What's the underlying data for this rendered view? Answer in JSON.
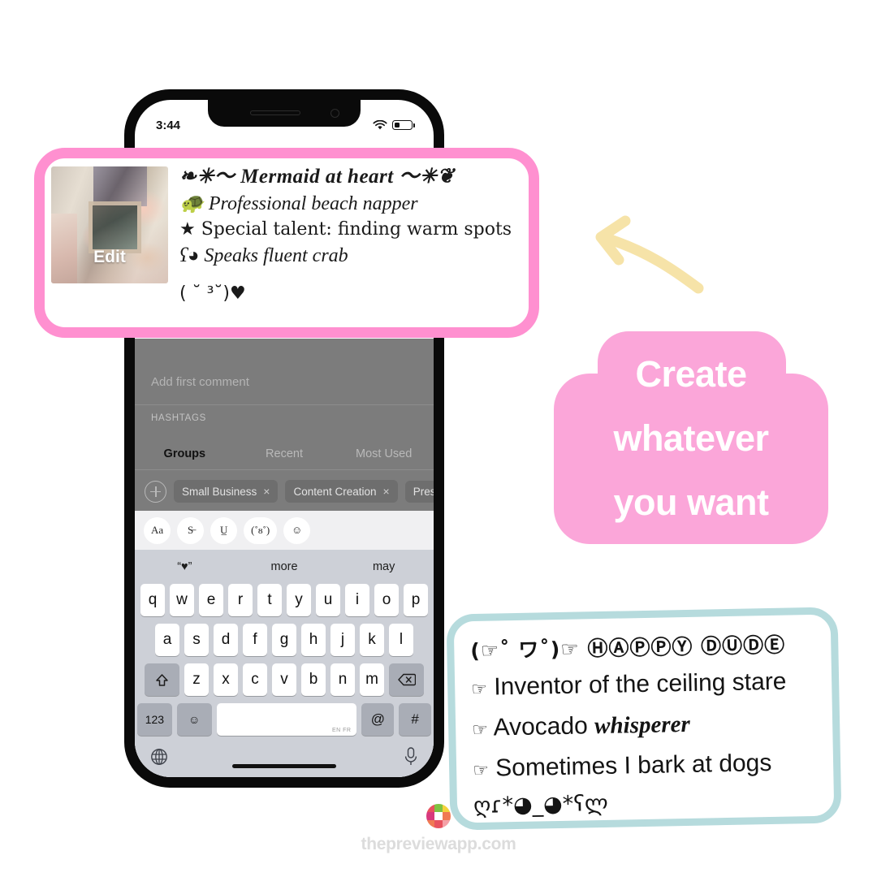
{
  "phone": {
    "status_bar": {
      "time": "3:44",
      "wifi_icon": "wifi-icon",
      "battery_icon": "battery-low-icon"
    },
    "comment_placeholder": "Add first comment",
    "hashtags_label": "HASHTAGS",
    "tabs": [
      {
        "label": "Groups",
        "active": true
      },
      {
        "label": "Recent",
        "active": false
      },
      {
        "label": "Most Used",
        "active": false
      }
    ],
    "chips": [
      {
        "label": "Small Business",
        "close": "×"
      },
      {
        "label": "Content Creation",
        "close": "×"
      },
      {
        "label": "Presets",
        "close": ""
      }
    ],
    "add_chip_icon": "plus-circle-icon",
    "format_buttons": [
      {
        "label": "Aa",
        "name": "font-size-button"
      },
      {
        "label": "S̶",
        "name": "strikethrough-button"
      },
      {
        "label": "U̲",
        "name": "underline-button"
      },
      {
        "label": "(˚ᴕ˚)",
        "name": "kaomoji-button"
      },
      {
        "label": "☺",
        "name": "emoji-button"
      }
    ],
    "keyboard": {
      "predictions": [
        "“♥”",
        "more",
        "may"
      ],
      "row1": [
        "q",
        "w",
        "e",
        "r",
        "t",
        "y",
        "u",
        "i",
        "o",
        "p"
      ],
      "row2": [
        "a",
        "s",
        "d",
        "f",
        "g",
        "h",
        "j",
        "k",
        "l"
      ],
      "shift_icon": "shift-icon",
      "row3": [
        "z",
        "x",
        "c",
        "v",
        "b",
        "n",
        "m"
      ],
      "backspace_icon": "backspace-icon",
      "numbers_key": "123",
      "emoji_key": "☺",
      "space_hint": "EN FR",
      "at_key": "@",
      "hash_key": "#",
      "globe_icon": "globe-icon",
      "mic_icon": "microphone-icon"
    }
  },
  "bio_card": {
    "thumbnail_label": "Edit",
    "lines": [
      "❧✳～ Mermaid at heart ～✳❦",
      "🐢 Professional beach napper",
      "★ Special talent: finding warm spots",
      "ʕ◕ Speaks fluent crab"
    ],
    "kaomoji": "( ˘ ³˘)♥",
    "border_color": "#ff90d0"
  },
  "callout": {
    "lines": [
      "Create",
      "whatever",
      "you want"
    ],
    "bg_color": "#fba6d9",
    "text_color": "#ffffff"
  },
  "arrow": {
    "name": "curved-arrow-left",
    "color": "#f6e3a8"
  },
  "teal_card": {
    "lines": [
      {
        "text": "(☞˚ ワ˚)☞ ⒽⒶⓅⓅⓎ ⒹⓊⒹⒺ",
        "style": "circled"
      },
      {
        "pointer": "☞",
        "text": "Inventor of the ceiling stare",
        "style": "plain"
      },
      {
        "pointer": "☞",
        "text": "Avocado ",
        "emph": "whisperer",
        "style": "emph"
      },
      {
        "pointer": "☞",
        "text": "Sometimes I bark at dogs",
        "style": "plain"
      },
      {
        "text": "ღɾ*◕_◕*ʕლ",
        "style": "kaomoji"
      }
    ],
    "border_color": "#b6dbdd"
  },
  "footer": {
    "url": "thepreviewapp.com",
    "logo_name": "preview-app-logo",
    "logo_colors": [
      "#e8525f",
      "#7fc242",
      "#f4d23c",
      "#d8397d",
      "#ffffff",
      "#f07a54",
      "#f07a54",
      "#e8525f",
      "#f4a0a7"
    ]
  }
}
